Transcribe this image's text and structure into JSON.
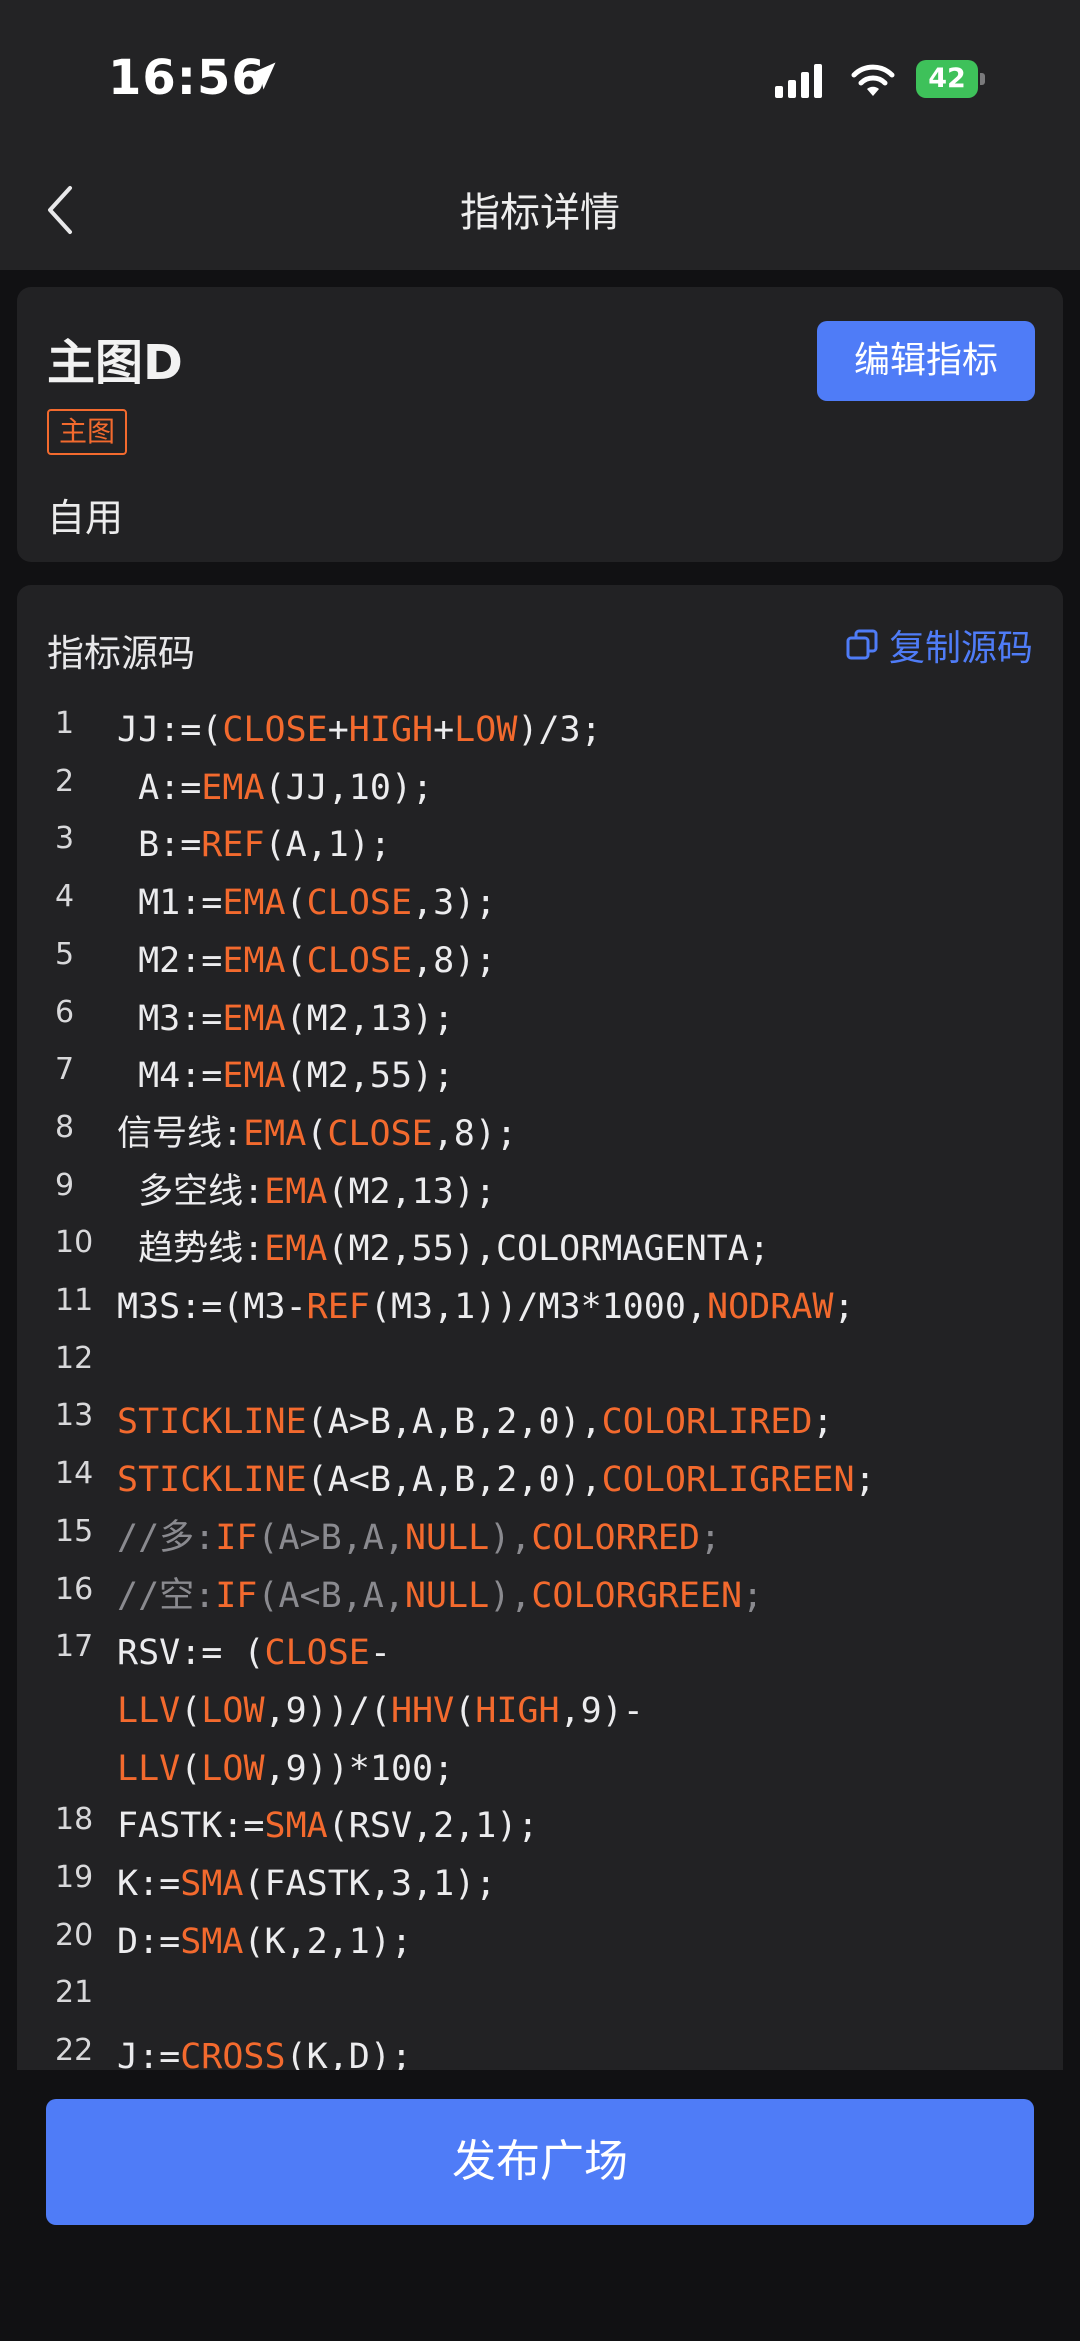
{
  "status_bar": {
    "time": "16:56",
    "battery": "42"
  },
  "nav": {
    "title": "指标详情"
  },
  "indicator": {
    "title": "主图D",
    "tag": "主图",
    "status": "自用",
    "edit_label": "编辑指标"
  },
  "source": {
    "header": "指标源码",
    "copy_label": "复制源码",
    "lines": [
      {
        "n": "1",
        "parts": [
          [
            "p",
            "JJ:=("
          ],
          [
            "k",
            "CLOSE"
          ],
          [
            "p",
            "+"
          ],
          [
            "k",
            "HIGH"
          ],
          [
            "p",
            "+"
          ],
          [
            "k",
            "LOW"
          ],
          [
            "p",
            ")/3;"
          ]
        ]
      },
      {
        "n": "2",
        "parts": [
          [
            "p",
            " A:="
          ],
          [
            "k",
            "EMA"
          ],
          [
            "p",
            "(JJ,10);"
          ]
        ]
      },
      {
        "n": "3",
        "parts": [
          [
            "p",
            " B:="
          ],
          [
            "k",
            "REF"
          ],
          [
            "p",
            "(A,1);"
          ]
        ]
      },
      {
        "n": "4",
        "parts": [
          [
            "p",
            " M1:="
          ],
          [
            "k",
            "EMA"
          ],
          [
            "p",
            "("
          ],
          [
            "k",
            "CLOSE"
          ],
          [
            "p",
            ",3);"
          ]
        ]
      },
      {
        "n": "5",
        "parts": [
          [
            "p",
            " M2:="
          ],
          [
            "k",
            "EMA"
          ],
          [
            "p",
            "("
          ],
          [
            "k",
            "CLOSE"
          ],
          [
            "p",
            ",8);"
          ]
        ]
      },
      {
        "n": "6",
        "parts": [
          [
            "p",
            " M3:="
          ],
          [
            "k",
            "EMA"
          ],
          [
            "p",
            "(M2,13);"
          ]
        ]
      },
      {
        "n": "7",
        "parts": [
          [
            "p",
            " M4:="
          ],
          [
            "k",
            "EMA"
          ],
          [
            "p",
            "(M2,55);"
          ]
        ]
      },
      {
        "n": "8",
        "parts": [
          [
            "p",
            "信号线:"
          ],
          [
            "k",
            "EMA"
          ],
          [
            "p",
            "("
          ],
          [
            "k",
            "CLOSE"
          ],
          [
            "p",
            ",8);"
          ]
        ]
      },
      {
        "n": "9",
        "parts": [
          [
            "p",
            " 多空线:"
          ],
          [
            "k",
            "EMA"
          ],
          [
            "p",
            "(M2,13);"
          ]
        ]
      },
      {
        "n": "10",
        "parts": [
          [
            "p",
            " 趋势线:"
          ],
          [
            "k",
            "EMA"
          ],
          [
            "p",
            "(M2,55),COLORMAGENTA;"
          ]
        ]
      },
      {
        "n": "11",
        "parts": [
          [
            "p",
            "M3S:=(M3-"
          ],
          [
            "k",
            "REF"
          ],
          [
            "p",
            "(M3,1))/M3*1000,"
          ],
          [
            "k",
            "NODRAW"
          ],
          [
            "p",
            ";"
          ]
        ]
      },
      {
        "n": "12",
        "parts": []
      },
      {
        "n": "13",
        "parts": [
          [
            "k",
            "STICKLINE"
          ],
          [
            "p",
            "(A>B,A,B,2,0),"
          ],
          [
            "k",
            "COLORLIRED"
          ],
          [
            "p",
            ";"
          ]
        ]
      },
      {
        "n": "14",
        "parts": [
          [
            "k",
            "STICKLINE"
          ],
          [
            "p",
            "(A<B,A,B,2,0),"
          ],
          [
            "k",
            "COLORLIGREEN"
          ],
          [
            "p",
            ";"
          ]
        ]
      },
      {
        "n": "15",
        "parts": [
          [
            "c",
            "//多:"
          ],
          [
            "k",
            "IF"
          ],
          [
            "c",
            "(A>B,A,"
          ],
          [
            "k",
            "NULL"
          ],
          [
            "c",
            "),"
          ],
          [
            "k",
            "COLORRED"
          ],
          [
            "c",
            ";"
          ]
        ]
      },
      {
        "n": "16",
        "parts": [
          [
            "c",
            "//空:"
          ],
          [
            "k",
            "IF"
          ],
          [
            "c",
            "(A<B,A,"
          ],
          [
            "k",
            "NULL"
          ],
          [
            "c",
            "),"
          ],
          [
            "k",
            "COLORGREEN"
          ],
          [
            "c",
            ";"
          ]
        ]
      },
      {
        "n": "17",
        "parts": [
          [
            "p",
            "RSV:= ("
          ],
          [
            "k",
            "CLOSE"
          ],
          [
            "p",
            "-\n"
          ],
          [
            "k",
            "LLV"
          ],
          [
            "p",
            "("
          ],
          [
            "k",
            "LOW"
          ],
          [
            "p",
            ",9))/("
          ],
          [
            "k",
            "HHV"
          ],
          [
            "p",
            "("
          ],
          [
            "k",
            "HIGH"
          ],
          [
            "p",
            ",9)-\n"
          ],
          [
            "k",
            "LLV"
          ],
          [
            "p",
            "("
          ],
          [
            "k",
            "LOW"
          ],
          [
            "p",
            ",9))*100;"
          ]
        ]
      },
      {
        "n": "18",
        "parts": [
          [
            "p",
            "FASTK:="
          ],
          [
            "k",
            "SMA"
          ],
          [
            "p",
            "(RSV,2,1);"
          ]
        ]
      },
      {
        "n": "19",
        "parts": [
          [
            "p",
            "K:="
          ],
          [
            "k",
            "SMA"
          ],
          [
            "p",
            "(FASTK,3,1);"
          ]
        ]
      },
      {
        "n": "20",
        "parts": [
          [
            "p",
            "D:="
          ],
          [
            "k",
            "SMA"
          ],
          [
            "p",
            "(K,2,1);"
          ]
        ]
      },
      {
        "n": "21",
        "parts": []
      },
      {
        "n": "22",
        "parts": [
          [
            "p",
            "J:="
          ],
          [
            "k",
            "CROSS"
          ],
          [
            "p",
            "(K,D);"
          ]
        ]
      }
    ]
  },
  "publish_label": "发布广场",
  "colors": {
    "accent": "#4f7cf7",
    "keyword": "#f36a2e",
    "comment": "#8a8a8f",
    "battery": "#3ec15a"
  }
}
